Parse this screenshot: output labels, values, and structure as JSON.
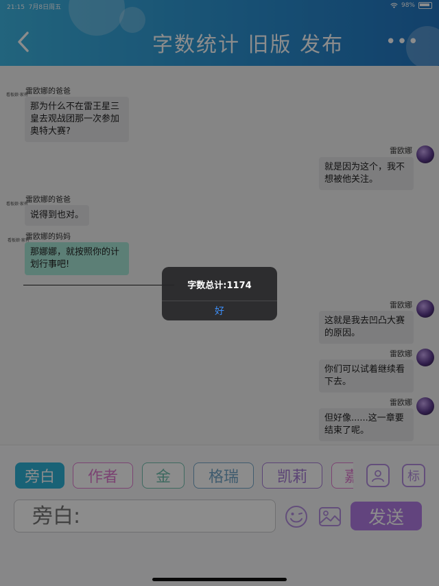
{
  "status_bar": {
    "time": "21:15",
    "date": "7月8日周五",
    "battery": "98%"
  },
  "header": {
    "title": "字数统计 旧版 发布",
    "more": "•••"
  },
  "messages": [
    {
      "side": "left",
      "sender": "雷欧娜的爸爸",
      "label": "看板娘·家有",
      "text": "那为什么不在雷王星三皇去观战团那一次参加奥特大赛?"
    },
    {
      "side": "right",
      "sender": "雷欧娜",
      "text": "就是因为这个，我不想被他关注。"
    },
    {
      "side": "left",
      "sender": "雷欧娜的爸爸",
      "label": "看板娘·家有",
      "text": "说得到也对。"
    },
    {
      "side": "left",
      "sender": "雷欧娜的妈妈",
      "label": "看板娘·家有",
      "text": "那娜娜，就按照你的计划行事吧!"
    },
    {
      "side": "right",
      "sender": "雷欧娜",
      "text": "这就是我去凹凸大赛的原因。"
    },
    {
      "side": "right",
      "sender": "雷欧娜",
      "text": "你们可以试着继续看下去。"
    },
    {
      "side": "right",
      "sender": "雷欧娜",
      "text": "但好像......这一章要结束了呢。"
    }
  ],
  "roles": [
    "旁白",
    "作者",
    "金",
    "格瑞",
    "凯莉",
    "嘉"
  ],
  "tag_button": "标",
  "input": {
    "placeholder": "旁白:"
  },
  "send_label": "发送",
  "alert": {
    "title": "字数总计:1174",
    "ok": "好"
  }
}
